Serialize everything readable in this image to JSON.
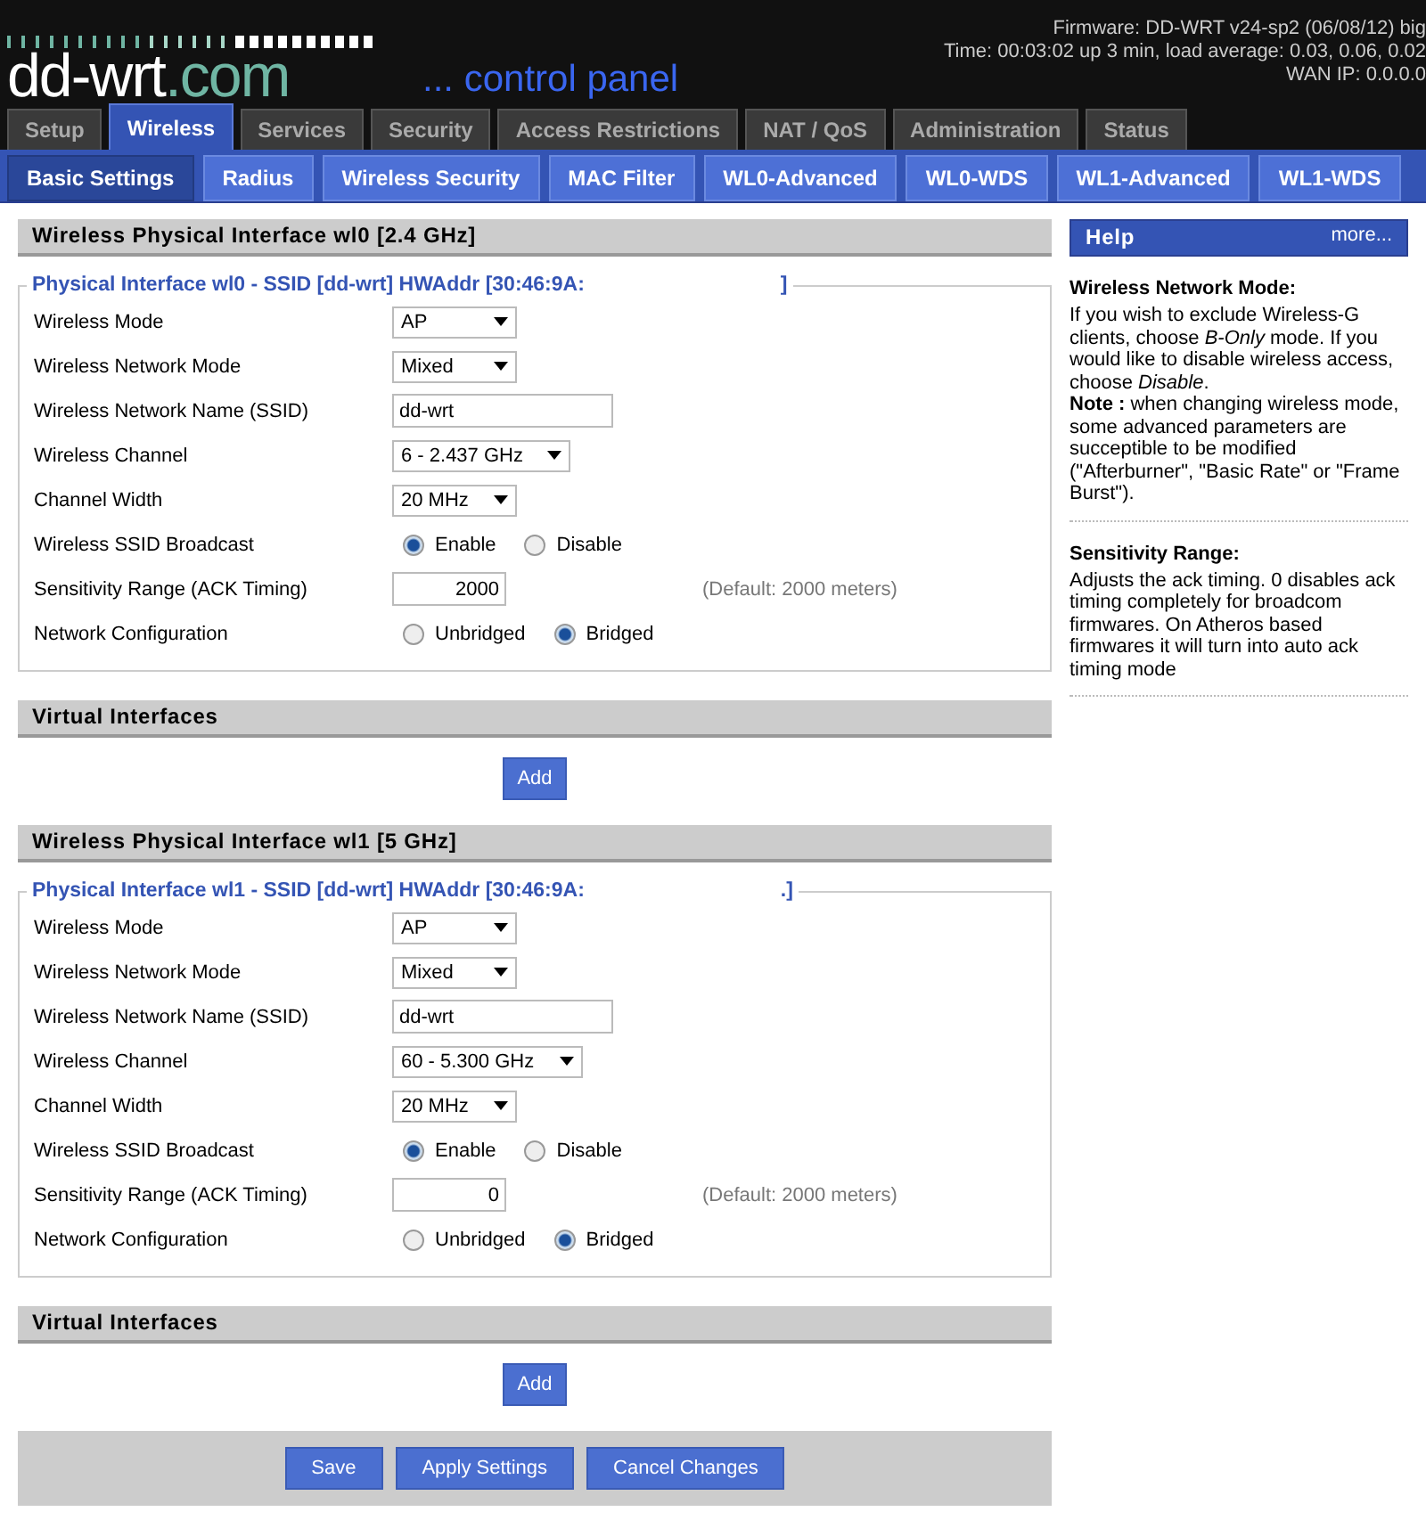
{
  "header": {
    "logo_main": "dd-wrt",
    "logo_suffix": ".com",
    "tagline": "... control panel",
    "info": [
      "Firmware: DD-WRT v24-sp2 (06/08/12) big",
      "Time: 00:03:02 up 3 min, load average: 0.03, 0.06, 0.02",
      "WAN IP: 0.0.0.0"
    ]
  },
  "tabs": [
    {
      "label": "Setup",
      "selected": false
    },
    {
      "label": "Wireless",
      "selected": true
    },
    {
      "label": "Services",
      "selected": false
    },
    {
      "label": "Security",
      "selected": false
    },
    {
      "label": "Access Restrictions",
      "selected": false
    },
    {
      "label": "NAT / QoS",
      "selected": false
    },
    {
      "label": "Administration",
      "selected": false
    },
    {
      "label": "Status",
      "selected": false
    }
  ],
  "subtabs": [
    {
      "label": "Basic Settings",
      "selected": true
    },
    {
      "label": "Radius",
      "selected": false
    },
    {
      "label": "Wireless Security",
      "selected": false
    },
    {
      "label": "MAC Filter",
      "selected": false
    },
    {
      "label": "WL0-Advanced",
      "selected": false
    },
    {
      "label": "WL0-WDS",
      "selected": false
    },
    {
      "label": "WL1-Advanced",
      "selected": false
    },
    {
      "label": "WL1-WDS",
      "selected": false
    }
  ],
  "interfaces": [
    {
      "title": "Wireless Physical Interface wl0 [2.4 GHz]",
      "legend": "Physical Interface wl0 - SSID [dd-wrt] HWAddr [30:46:9A:",
      "legend_end": "]",
      "rows": [
        {
          "kind": "select",
          "label": "Wireless Mode",
          "value": "AP"
        },
        {
          "kind": "select",
          "label": "Wireless Network Mode",
          "value": "Mixed"
        },
        {
          "kind": "text",
          "label": "Wireless Network Name (SSID)",
          "value": "dd-wrt"
        },
        {
          "kind": "select",
          "label": "Wireless Channel",
          "value": "6 - 2.437 GHz"
        },
        {
          "kind": "select",
          "label": "Channel Width",
          "value": "20 MHz"
        },
        {
          "kind": "radio",
          "label": "Wireless SSID Broadcast",
          "options": [
            {
              "label": "Enable",
              "selected": true
            },
            {
              "label": "Disable",
              "selected": false
            }
          ]
        },
        {
          "kind": "number",
          "label": "Sensitivity Range (ACK Timing)",
          "value": "2000",
          "hint": "(Default: 2000 meters)"
        },
        {
          "kind": "radio",
          "label": "Network Configuration",
          "options": [
            {
              "label": "Unbridged",
              "selected": false
            },
            {
              "label": "Bridged",
              "selected": true
            }
          ]
        }
      ],
      "virtual_title": "Virtual Interfaces",
      "add_button": "Add"
    },
    {
      "title": "Wireless Physical Interface wl1 [5 GHz]",
      "legend": "Physical Interface wl1 - SSID [dd-wrt] HWAddr [30:46:9A:",
      "legend_end": ".]",
      "rows": [
        {
          "kind": "select",
          "label": "Wireless Mode",
          "value": "AP"
        },
        {
          "kind": "select",
          "label": "Wireless Network Mode",
          "value": "Mixed"
        },
        {
          "kind": "text",
          "label": "Wireless Network Name (SSID)",
          "value": "dd-wrt"
        },
        {
          "kind": "select",
          "label": "Wireless Channel",
          "value": "60 - 5.300 GHz"
        },
        {
          "kind": "select",
          "label": "Channel Width",
          "value": "20 MHz"
        },
        {
          "kind": "radio",
          "label": "Wireless SSID Broadcast",
          "options": [
            {
              "label": "Enable",
              "selected": true
            },
            {
              "label": "Disable",
              "selected": false
            }
          ]
        },
        {
          "kind": "number",
          "label": "Sensitivity Range (ACK Timing)",
          "value": "0",
          "hint": "(Default: 2000 meters)"
        },
        {
          "kind": "radio",
          "label": "Network Configuration",
          "options": [
            {
              "label": "Unbridged",
              "selected": false
            },
            {
              "label": "Bridged",
              "selected": true
            }
          ]
        }
      ],
      "virtual_title": "Virtual Interfaces",
      "add_button": "Add"
    }
  ],
  "footer_buttons": [
    "Save",
    "Apply Settings",
    "Cancel Changes"
  ],
  "help": {
    "title": "Help",
    "more": "more...",
    "sections": [
      {
        "heading": "Wireless Network Mode:",
        "text": "If you wish to exclude Wireless-G clients, choose *B-Only* mode. If you would like to disable wireless access, choose *Disable*.",
        "note_label": "Note :",
        "note": " when changing wireless mode, some advanced parameters are succeptible to be modified (\"Afterburner\", \"Basic Rate\" or \"Frame Burst\")."
      },
      {
        "heading": "Sensitivity Range:",
        "text": "Adjusts the ack timing. 0 disables ack timing completely for broadcom firmwares. On Atheros based firmwares it will turn into auto ack timing mode"
      }
    ]
  }
}
